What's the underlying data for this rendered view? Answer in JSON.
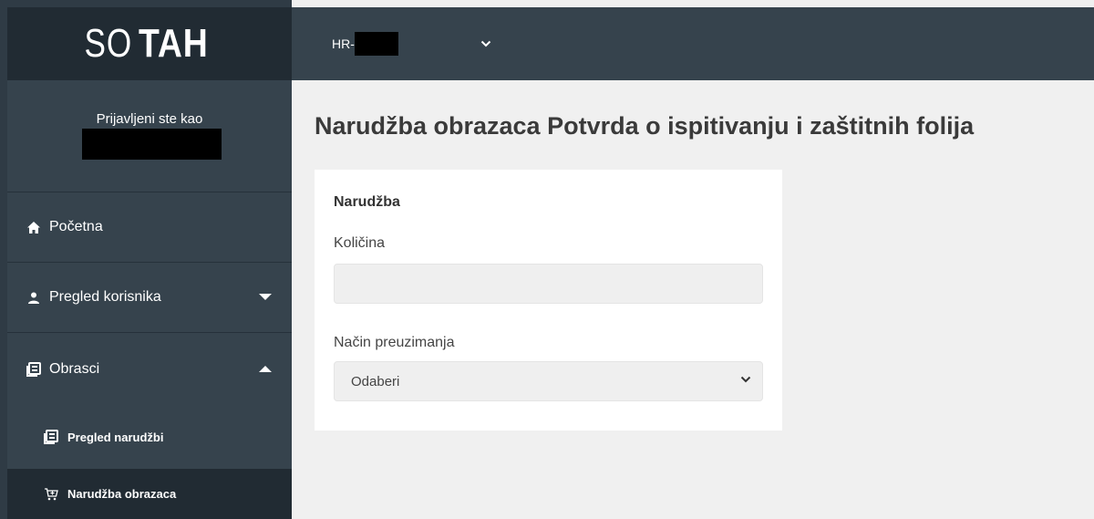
{
  "logo": {
    "part1": "SO",
    "part2": "TAH"
  },
  "topbar": {
    "org_prefix": "HR-"
  },
  "sidebar": {
    "logged_in_label": "Prijavljeni ste kao",
    "items": [
      {
        "label": "Početna",
        "icon": "home-icon"
      },
      {
        "label": "Pregled korisnika",
        "icon": "user-icon"
      },
      {
        "label": "Obrasci",
        "icon": "forms-icon"
      }
    ],
    "subitems": [
      {
        "label": "Pregled narudžbi",
        "icon": "forms-icon"
      },
      {
        "label": "Narudžba obrazaca",
        "icon": "cart-icon"
      }
    ]
  },
  "main": {
    "title": "Narudžba obrazaca Potvrda o ispitivanju i zaštitnih folija",
    "card": {
      "title": "Narudžba",
      "quantity_label": "Količina",
      "quantity_value": "",
      "method_label": "Način preuzimanja",
      "method_selected": "Odaberi"
    }
  },
  "colors": {
    "sidebar_bg": "#36434d",
    "sidebar_dark": "#212b33",
    "page_bg": "#f0f0f0"
  }
}
